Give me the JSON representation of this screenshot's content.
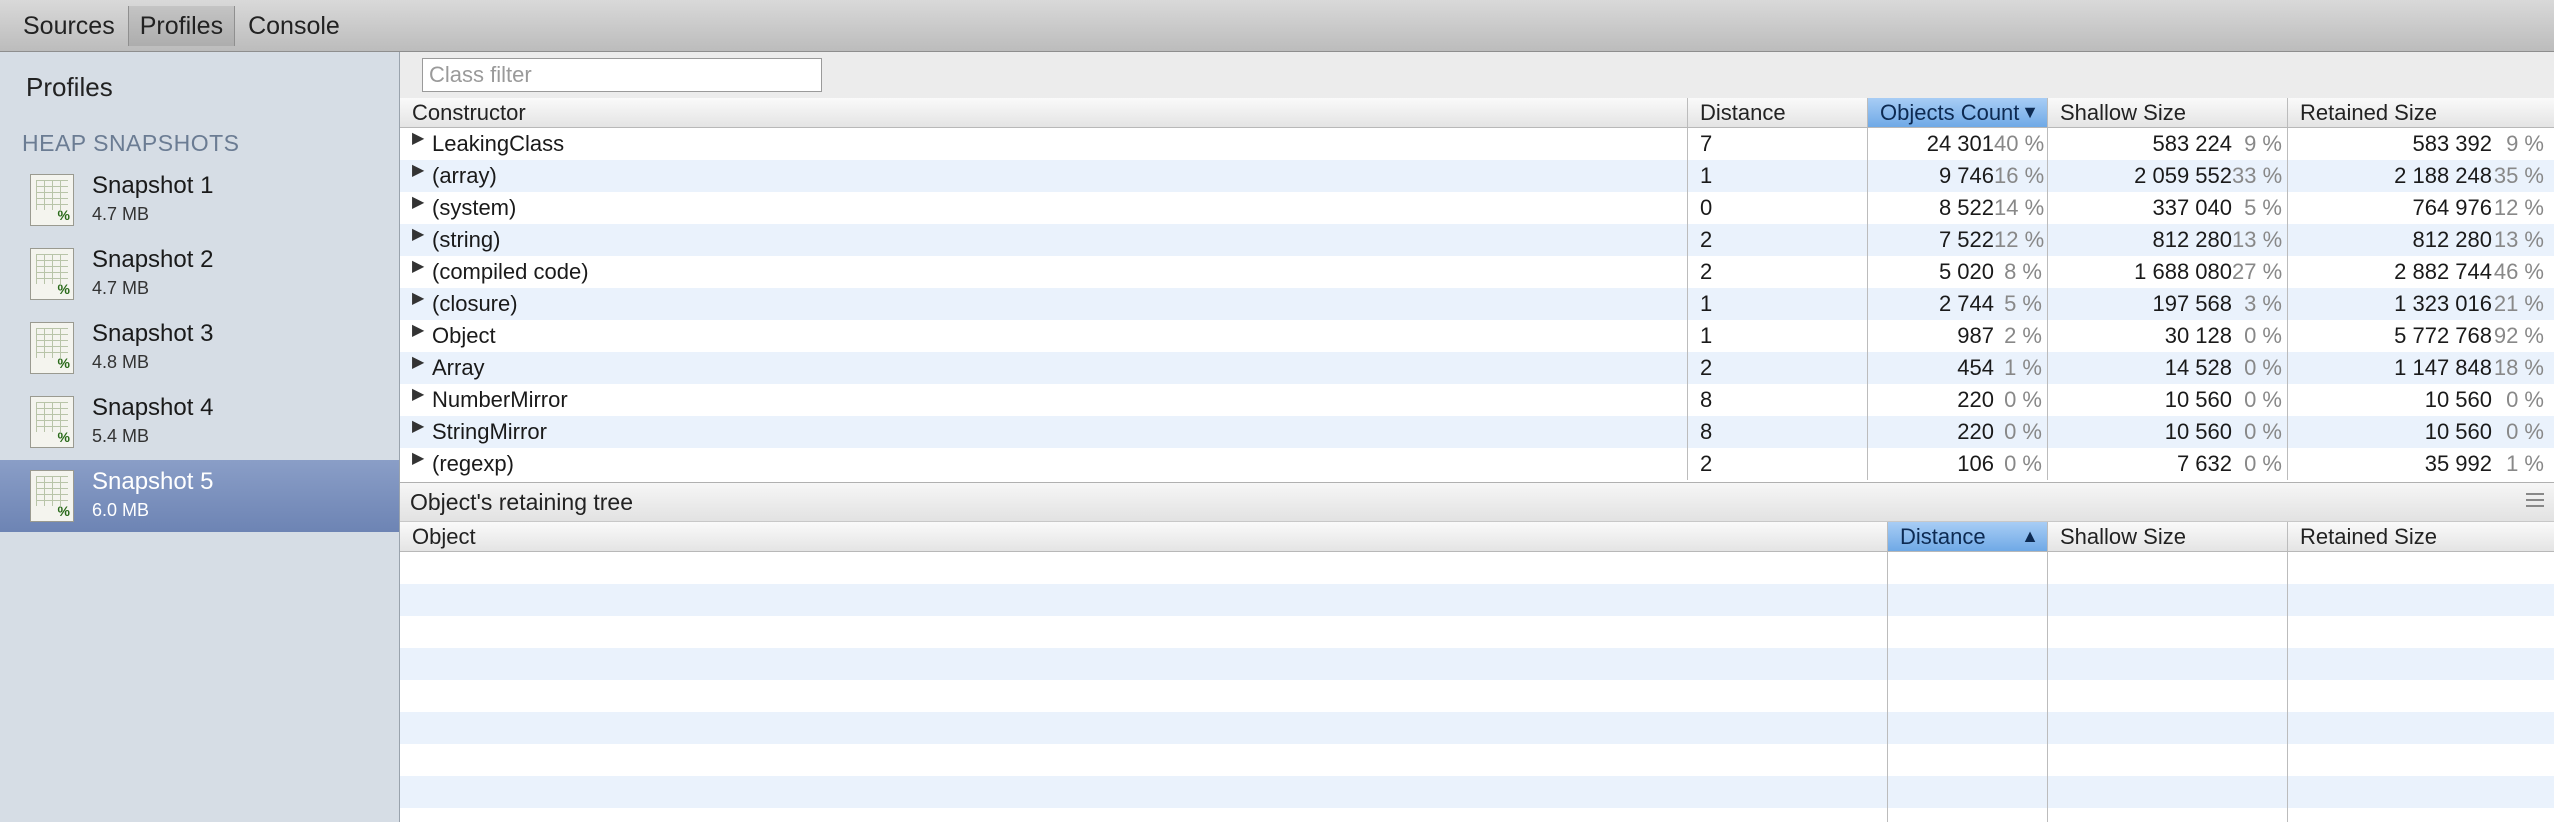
{
  "toolbar": {
    "tabs": [
      {
        "label": "Sources"
      },
      {
        "label": "Profiles"
      },
      {
        "label": "Console"
      }
    ],
    "active_tab": "Profiles"
  },
  "sidebar": {
    "title": "Profiles",
    "section": "HEAP SNAPSHOTS",
    "snapshots": [
      {
        "name": "Snapshot 1",
        "size": "4.7 MB"
      },
      {
        "name": "Snapshot 2",
        "size": "4.7 MB"
      },
      {
        "name": "Snapshot 3",
        "size": "4.8 MB"
      },
      {
        "name": "Snapshot 4",
        "size": "5.4 MB"
      },
      {
        "name": "Snapshot 5",
        "size": "6.0 MB"
      }
    ],
    "selected": "Snapshot 5",
    "thumb_icon": "spreadsheet-percent-icon"
  },
  "filter": {
    "placeholder": "Class filter",
    "value": ""
  },
  "constructors_table": {
    "headers": {
      "constructor": "Constructor",
      "distance": "Distance",
      "objects_count": "Objects Count",
      "shallow_size": "Shallow Size",
      "retained_size": "Retained Size"
    },
    "sorted_column": "Objects Count",
    "sort_direction": "descending",
    "rows": [
      {
        "name": "LeakingClass",
        "distance": "7",
        "count": "24 301",
        "count_pct": "40 %",
        "shallow": "583 224",
        "shallow_pct": "9 %",
        "retained": "583 392",
        "retained_pct": "9 %"
      },
      {
        "name": "(array)",
        "distance": "1",
        "count": "9 746",
        "count_pct": "16 %",
        "shallow": "2 059 552",
        "shallow_pct": "33 %",
        "retained": "2 188 248",
        "retained_pct": "35 %"
      },
      {
        "name": "(system)",
        "distance": "0",
        "count": "8 522",
        "count_pct": "14 %",
        "shallow": "337 040",
        "shallow_pct": "5 %",
        "retained": "764 976",
        "retained_pct": "12 %"
      },
      {
        "name": "(string)",
        "distance": "2",
        "count": "7 522",
        "count_pct": "12 %",
        "shallow": "812 280",
        "shallow_pct": "13 %",
        "retained": "812 280",
        "retained_pct": "13 %"
      },
      {
        "name": "(compiled code)",
        "distance": "2",
        "count": "5 020",
        "count_pct": "8 %",
        "shallow": "1 688 080",
        "shallow_pct": "27 %",
        "retained": "2 882 744",
        "retained_pct": "46 %"
      },
      {
        "name": "(closure)",
        "distance": "1",
        "count": "2 744",
        "count_pct": "5 %",
        "shallow": "197 568",
        "shallow_pct": "3 %",
        "retained": "1 323 016",
        "retained_pct": "21 %"
      },
      {
        "name": "Object",
        "distance": "1",
        "count": "987",
        "count_pct": "2 %",
        "shallow": "30 128",
        "shallow_pct": "0 %",
        "retained": "5 772 768",
        "retained_pct": "92 %"
      },
      {
        "name": "Array",
        "distance": "2",
        "count": "454",
        "count_pct": "1 %",
        "shallow": "14 528",
        "shallow_pct": "0 %",
        "retained": "1 147 848",
        "retained_pct": "18 %"
      },
      {
        "name": "NumberMirror",
        "distance": "8",
        "count": "220",
        "count_pct": "0 %",
        "shallow": "10 560",
        "shallow_pct": "0 %",
        "retained": "10 560",
        "retained_pct": "0 %"
      },
      {
        "name": "StringMirror",
        "distance": "8",
        "count": "220",
        "count_pct": "0 %",
        "shallow": "10 560",
        "shallow_pct": "0 %",
        "retained": "10 560",
        "retained_pct": "0 %"
      },
      {
        "name": "(regexp)",
        "distance": "2",
        "count": "106",
        "count_pct": "0 %",
        "shallow": "7 632",
        "shallow_pct": "0 %",
        "retained": "35 992",
        "retained_pct": "1 %"
      }
    ]
  },
  "retaining_tree": {
    "title": "Object's retaining tree",
    "headers": {
      "object": "Object",
      "distance": "Distance",
      "shallow_size": "Shallow Size",
      "retained_size": "Retained Size"
    },
    "sorted_column": "Distance",
    "sort_direction": "ascending",
    "rows": []
  },
  "colors": {
    "sorted_header": "#6fa9e6",
    "row_stripe": "#eaf2fc",
    "selected_snapshot": "#7189b8",
    "sidebar_bg": "#d6dde5"
  }
}
